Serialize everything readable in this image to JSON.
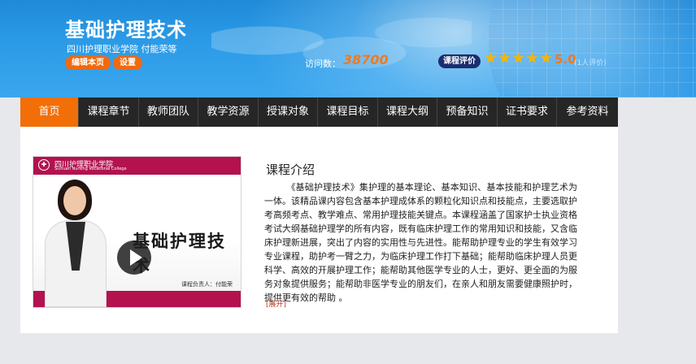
{
  "header": {
    "course_title": "基础护理技术",
    "school_teacher": "四川护理职业学院 付能荣等",
    "edit_label": "编辑本页",
    "settings_label": "设置",
    "visits_label": "访问数：",
    "visits_count": "38700",
    "eval_label": "课程评价",
    "stars": 5,
    "score": "5.0",
    "rating_count": "(1人评价)"
  },
  "nav": {
    "items": [
      {
        "label": "首页",
        "active": true
      },
      {
        "label": "课程章节",
        "active": false
      },
      {
        "label": "教师团队",
        "active": false
      },
      {
        "label": "教学资源",
        "active": false
      },
      {
        "label": "授课对象",
        "active": false
      },
      {
        "label": "课程目标",
        "active": false
      },
      {
        "label": "课程大纲",
        "active": false
      },
      {
        "label": "预备知识",
        "active": false
      },
      {
        "label": "证书要求",
        "active": false
      },
      {
        "label": "参考资料",
        "active": false
      }
    ]
  },
  "video": {
    "school_cn": "四川护理职业学院",
    "school_en": "Sichuan Nursing Vocational College",
    "poster_title": "基础护理技术",
    "lecturer": "课程负责人：付能荣"
  },
  "intro": {
    "title": "课程介绍",
    "text": "《基础护理技术》集护理的基本理论、基本知识、基本技能和护理艺术为一体。该精品课内容包含基本护理成体系的颗粒化知识点和技能点，主要选取护考高频考点、教学难点、常用护理技能关键点。本课程涵盖了国家护士执业资格考试大纲基础护理学的所有内容，既有临床护理工作的常用知识和技能，又含临床护理新进展，突出了内容的实用性与先进性。能帮助护理专业的学生有效学习专业课程，助护考一臂之力，为临床护理工作打下基础；能帮助临床护理人员更科学、高效的开展护理工作；能帮助其他医学专业的人士，更好、更全面的为服务对象提供服务；能帮助非医学专业的朋友们，在亲人和朋友需要健康照护时，提供更有效的帮助 。",
    "expand_label": "[展开]"
  },
  "colors": {
    "accent": "#f26e07",
    "nav_bg": "#262626",
    "banner_blue": "#2b9ae6",
    "eval_bg": "#1a2e6e",
    "star": "#f7b500",
    "poster_magenta": "#b3124f"
  }
}
